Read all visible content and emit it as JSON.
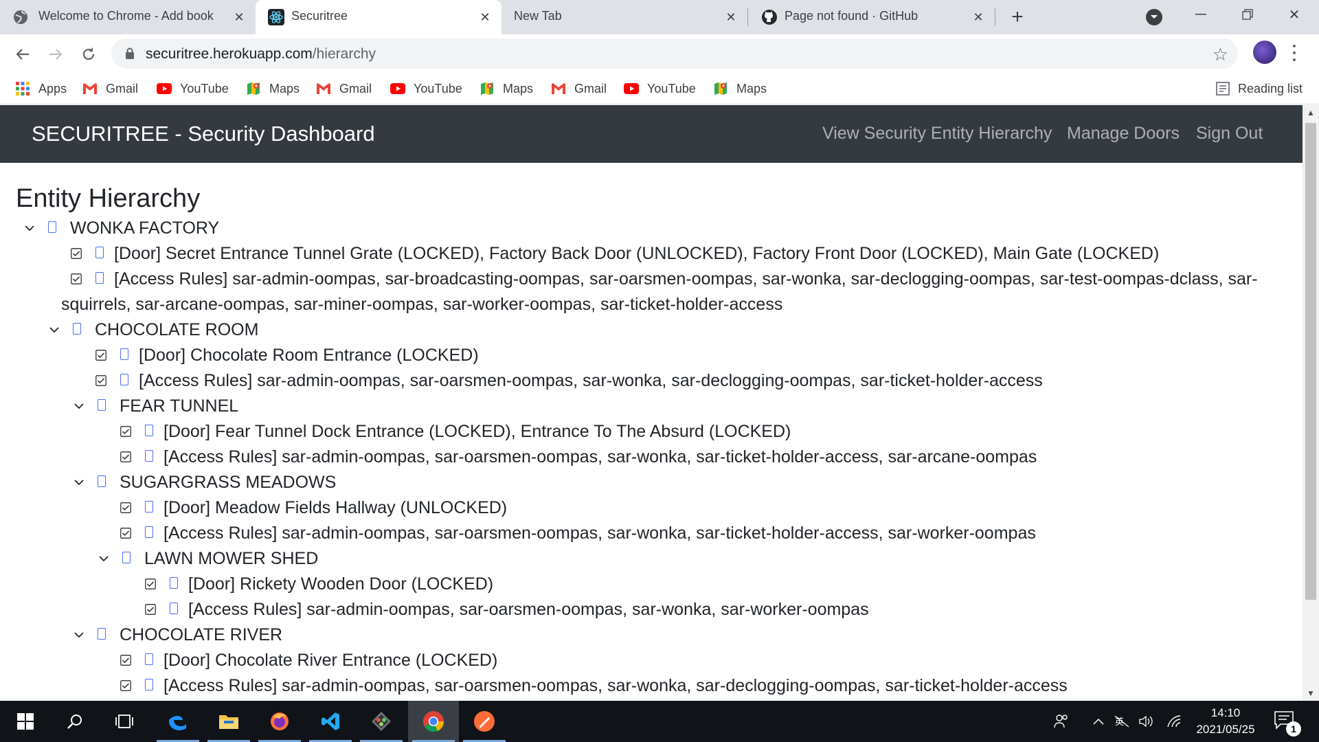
{
  "browser": {
    "tabs": [
      {
        "title": "Welcome to Chrome - Add book",
        "active": false
      },
      {
        "title": "Securitree",
        "active": true
      },
      {
        "title": "New Tab",
        "active": false
      },
      {
        "title": "Page not found · GitHub",
        "active": false
      }
    ],
    "url_host": "securitree.herokuapp.com",
    "url_path": "/hierarchy",
    "bookmarks": [
      {
        "label": "Apps",
        "icon": "apps-grid-icon"
      },
      {
        "label": "Gmail",
        "icon": "gmail-icon"
      },
      {
        "label": "YouTube",
        "icon": "youtube-icon"
      },
      {
        "label": "Maps",
        "icon": "maps-icon"
      },
      {
        "label": "Gmail",
        "icon": "gmail-icon"
      },
      {
        "label": "YouTube",
        "icon": "youtube-icon"
      },
      {
        "label": "Maps",
        "icon": "maps-icon"
      },
      {
        "label": "Gmail",
        "icon": "gmail-icon"
      },
      {
        "label": "YouTube",
        "icon": "youtube-icon"
      },
      {
        "label": "Maps",
        "icon": "maps-icon"
      }
    ],
    "reading_list": "Reading list"
  },
  "app": {
    "brand": "SECURITREE - Security Dashboard",
    "nav": {
      "hierarchy": "View Security Entity Hierarchy",
      "doors": "Manage Doors",
      "signout": "Sign Out"
    },
    "page_title": "Entity Hierarchy"
  },
  "tree": [
    {
      "type": "entity",
      "level": 0,
      "text": "WONKA FACTORY"
    },
    {
      "type": "leaf",
      "level": 1,
      "text": "[Door] Secret Entrance Tunnel Grate (LOCKED), Factory Back Door (UNLOCKED), Factory Front Door (LOCKED), Main Gate (LOCKED)"
    },
    {
      "type": "leaf-wrap",
      "level": 1,
      "text": "[Access Rules] sar-admin-oompas, sar-broadcasting-oompas, sar-oarsmen-oompas, sar-wonka, sar-declogging-oompas, sar-test-oompas-dclass, sar-",
      "text2": "squirrels, sar-arcane-oompas, sar-miner-oompas, sar-worker-oompas, sar-ticket-holder-access"
    },
    {
      "type": "entity",
      "level": 1,
      "text": "CHOCOLATE ROOM"
    },
    {
      "type": "leaf",
      "level": 2,
      "text": "[Door] Chocolate Room Entrance (LOCKED)"
    },
    {
      "type": "leaf",
      "level": 2,
      "text": "[Access Rules] sar-admin-oompas, sar-oarsmen-oompas, sar-wonka, sar-declogging-oompas, sar-ticket-holder-access"
    },
    {
      "type": "entity",
      "level": 2,
      "text": "FEAR TUNNEL"
    },
    {
      "type": "leaf",
      "level": 3,
      "text": "[Door] Fear Tunnel Dock Entrance (LOCKED), Entrance To The Absurd (LOCKED)"
    },
    {
      "type": "leaf",
      "level": 3,
      "text": "[Access Rules] sar-admin-oompas, sar-oarsmen-oompas, sar-wonka, sar-ticket-holder-access, sar-arcane-oompas"
    },
    {
      "type": "entity",
      "level": 2,
      "text": "SUGARGRASS MEADOWS"
    },
    {
      "type": "leaf",
      "level": 3,
      "text": "[Door] Meadow Fields Hallway (UNLOCKED)"
    },
    {
      "type": "leaf",
      "level": 3,
      "text": "[Access Rules] sar-admin-oompas, sar-oarsmen-oompas, sar-wonka, sar-ticket-holder-access, sar-worker-oompas"
    },
    {
      "type": "entity",
      "level": 3,
      "text": "LAWN MOWER SHED"
    },
    {
      "type": "leaf",
      "level": 4,
      "text": "[Door] Rickety Wooden Door (LOCKED)"
    },
    {
      "type": "leaf",
      "level": 4,
      "text": "[Access Rules] sar-admin-oompas, sar-oarsmen-oompas, sar-wonka, sar-worker-oompas"
    },
    {
      "type": "entity",
      "level": 2,
      "text": "CHOCOLATE RIVER"
    },
    {
      "type": "leaf",
      "level": 3,
      "text": "[Door] Chocolate River Entrance (LOCKED)"
    },
    {
      "type": "leaf",
      "level": 3,
      "text": "[Access Rules] sar-admin-oompas, sar-oarsmen-oompas, sar-wonka, sar-declogging-oompas, sar-ticket-holder-access"
    }
  ],
  "taskbar": {
    "time": "14:10",
    "date": "2021/05/25",
    "notification_count": "1"
  },
  "colors": {
    "navbar_bg": "#343a40",
    "icon_box": "#4a6cf7",
    "tab_strip": "#dee1e6"
  }
}
